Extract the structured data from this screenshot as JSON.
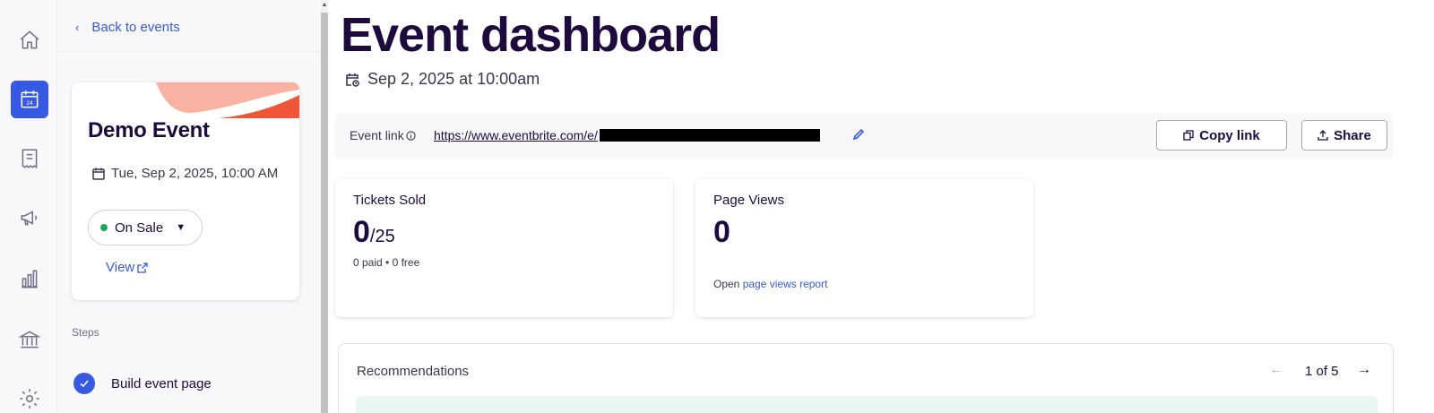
{
  "rail": {
    "items": [
      {
        "name": "home-icon",
        "active": false
      },
      {
        "name": "calendar-icon",
        "active": true,
        "badge": "24"
      },
      {
        "name": "receipt-icon",
        "active": false
      },
      {
        "name": "megaphone-icon",
        "active": false
      },
      {
        "name": "bar-chart-icon",
        "active": false
      },
      {
        "name": "bank-icon",
        "active": false
      },
      {
        "name": "gear-icon",
        "active": false
      }
    ]
  },
  "panel": {
    "back_label": "Back to events",
    "event_name": "Demo Event",
    "event_date": "Tue, Sep 2, 2025, 10:00 AM",
    "status": "On Sale",
    "view_label": "View",
    "steps_label": "Steps",
    "steps": [
      {
        "label": "Build event page",
        "done": true
      }
    ]
  },
  "main": {
    "title": "Event dashboard",
    "date": "Sep 2, 2025 at 10:00am",
    "event_link_label": "Event link",
    "event_link_url": "https://www.eventbrite.com/e/",
    "copy_link_label": "Copy link",
    "share_label": "Share",
    "tickets": {
      "title": "Tickets Sold",
      "sold": "0",
      "capacity": "/25",
      "breakdown": "0 paid • 0 free"
    },
    "views": {
      "title": "Page Views",
      "count": "0",
      "open_prefix": "Open",
      "report_link": "page views report"
    },
    "recommendations": {
      "title": "Recommendations",
      "pager": "1 of 5"
    }
  },
  "colors": {
    "brand_blue": "#3659e3",
    "ink": "#1e0a3c",
    "status_green": "#1ca45a",
    "accent_orange": "#f05537",
    "accent_peach": "#f9b2a1"
  }
}
